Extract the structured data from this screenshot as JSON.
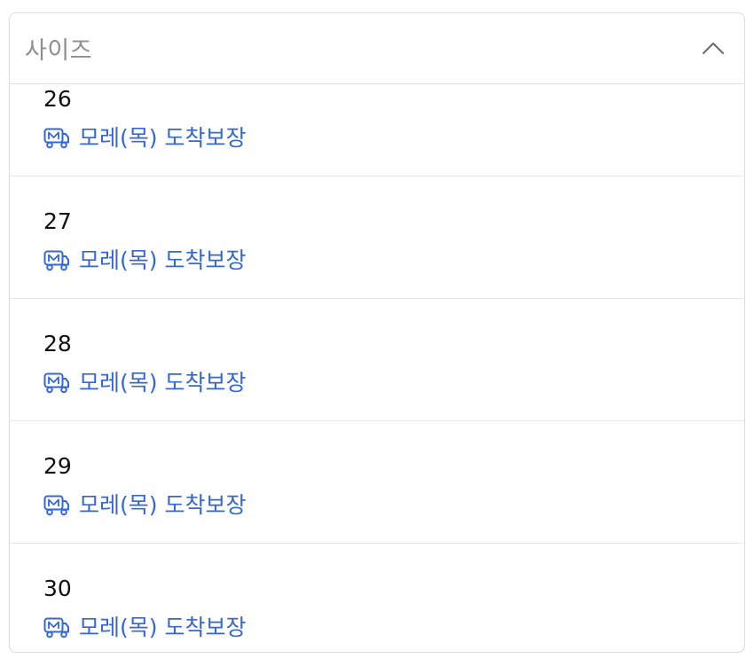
{
  "dropdown": {
    "label": "사이즈",
    "expanded": true,
    "chevron_icon": "chevron-up-icon"
  },
  "options": [
    {
      "size": "26",
      "delivery": "모레(목) 도착보장",
      "icon": "truck-icon"
    },
    {
      "size": "27",
      "delivery": "모레(목) 도착보장",
      "icon": "truck-icon"
    },
    {
      "size": "28",
      "delivery": "모레(목) 도착보장",
      "icon": "truck-icon"
    },
    {
      "size": "29",
      "delivery": "모레(목) 도착보장",
      "icon": "truck-icon"
    },
    {
      "size": "30",
      "delivery": "모레(목) 도착보장",
      "icon": "truck-icon"
    }
  ],
  "colors": {
    "accent": "#3467d6",
    "placeholder": "#8e8e8e",
    "border": "#dcdcdc",
    "divider": "#e6e6e6",
    "text": "#111111"
  }
}
